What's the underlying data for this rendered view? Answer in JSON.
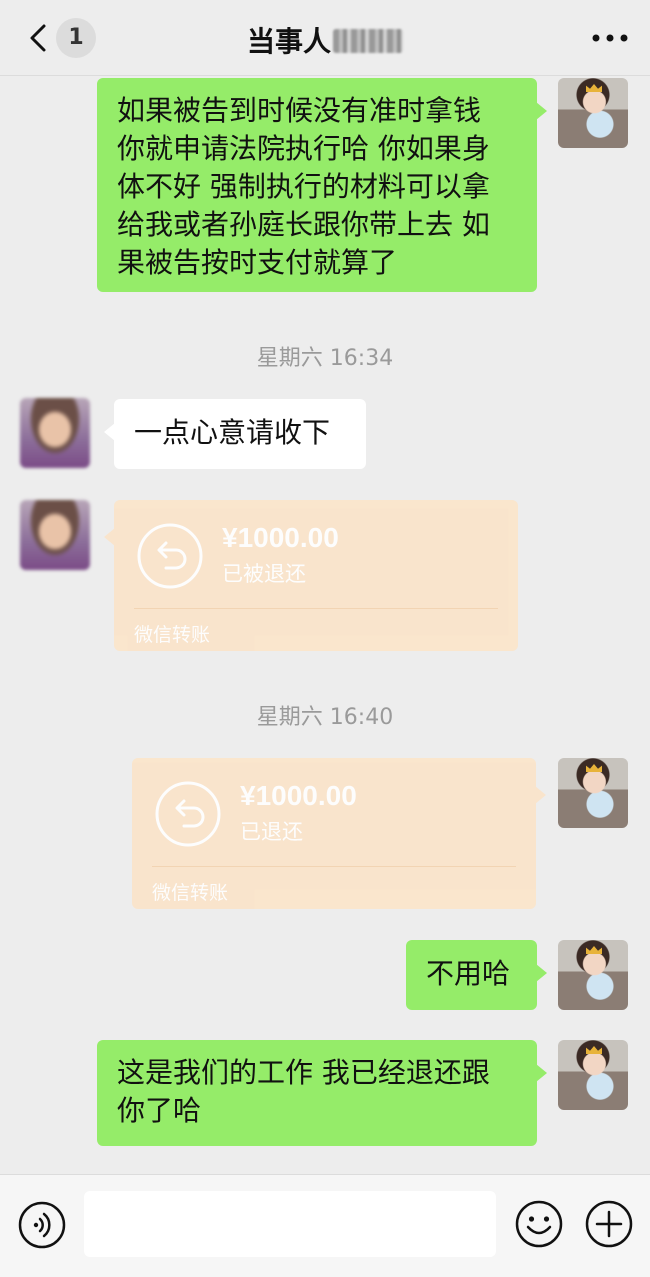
{
  "header": {
    "unread_count": "1",
    "title": "当事人"
  },
  "messages": {
    "m1": {
      "lines": [
        "如果被告到时候没有准时拿钱",
        "你就申请法院执行哈 你如果身",
        "体不好 强制执行的材料可以拿",
        "给我或者孙庭长跟你带上去 如",
        "果被告按时支付就算了"
      ]
    },
    "time1": "星期六 16:34",
    "m2": "一点心意请收下",
    "transfer1": {
      "amount": "¥1000.00",
      "status": "已被退还",
      "label": "微信转账"
    },
    "time2": "星期六 16:40",
    "transfer2": {
      "amount": "¥1000.00",
      "status": "已退还",
      "label": "微信转账"
    },
    "m3": "不用哈",
    "m4": {
      "lines": [
        "这是我们的工作 我已经退还跟",
        "你了哈"
      ]
    }
  },
  "icons": {
    "back": "chevron-left-icon",
    "more": "ellipsis-icon",
    "voice": "voice-icon",
    "emoji": "emoji-icon",
    "plus": "plus-icon",
    "return": "return-arrow-icon"
  },
  "colors": {
    "self_bubble": "#95ec69",
    "other_bubble": "#ffffff",
    "transfer_card": "#fbe4c9",
    "background": "#ededed"
  }
}
